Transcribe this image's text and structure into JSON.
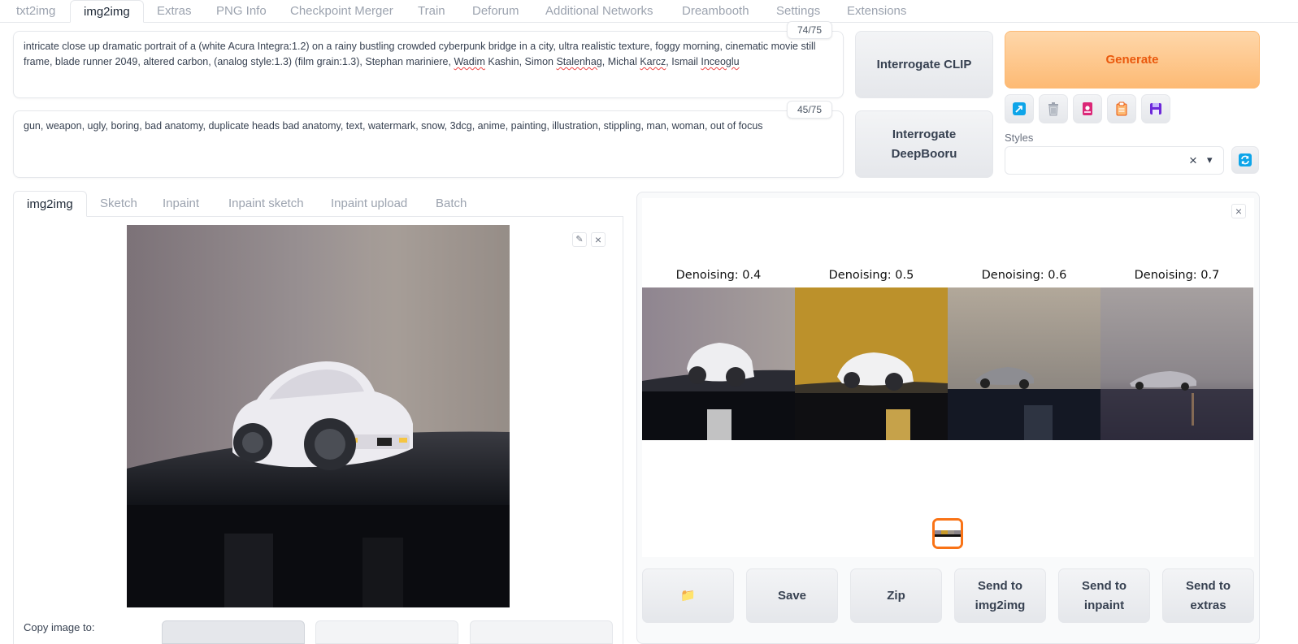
{
  "top_tabs": [
    {
      "label": "txt2img"
    },
    {
      "label": "img2img"
    },
    {
      "label": "Extras"
    },
    {
      "label": "PNG Info"
    },
    {
      "label": "Checkpoint Merger"
    },
    {
      "label": "Train"
    },
    {
      "label": "Deforum"
    },
    {
      "label": "Additional Networks"
    },
    {
      "label": "Dreambooth"
    },
    {
      "label": "Settings"
    },
    {
      "label": "Extensions"
    }
  ],
  "active_top_tab": "img2img",
  "prompt": {
    "text_plain": "intricate close up dramatic portrait of a (white Acura Integra:1.2) on a rainy bustling crowded cyberpunk bridge in a city, ultra realistic texture, foggy morning, cinematic movie still frame, blade runner 2049, altered carbon, (analog style:1.3) (film grain:1.3), Stephan mariniere, ",
    "misspelled_1": "Wadim",
    "word_kashin": "Kashin",
    "text_mid_1": ", Simon ",
    "misspelled_2": "Stalenhag",
    "text_mid_2": ", Michal ",
    "misspelled_3": "Karcz",
    "text_mid_3": ", Ismail ",
    "misspelled_4": "Inceoglu",
    "token_count": "74/75"
  },
  "negative_prompt": {
    "text": "gun, weapon, ugly, boring, bad anatomy, duplicate heads bad anatomy, text, watermark, snow, 3dcg, anime, painting, illustration, stippling, man, woman, out of focus",
    "token_count": "45/75"
  },
  "buttons": {
    "interrogate_clip": "Interrogate CLIP",
    "interrogate_deepbooru_1": "Interrogate",
    "interrogate_deepbooru_2": "DeepBooru",
    "generate": "Generate"
  },
  "styles": {
    "label": "Styles",
    "clear_glyph": "×",
    "arrow_glyph": "▾"
  },
  "sub_tabs": [
    {
      "label": "img2img"
    },
    {
      "label": "Sketch"
    },
    {
      "label": "Inpaint"
    },
    {
      "label": "Inpaint sketch"
    },
    {
      "label": "Inpaint upload"
    },
    {
      "label": "Batch"
    }
  ],
  "input_image": {
    "edit_glyph": "✎",
    "close_glyph": "×"
  },
  "copy_image_to": "Copy image to:",
  "gallery": {
    "close_glyph": "×",
    "captions": [
      "Denoising: 0.4",
      "Denoising: 0.5",
      "Denoising: 0.6",
      "Denoising: 0.7"
    ]
  },
  "output_buttons": {
    "folder_glyph": "📁",
    "save": "Save",
    "zip": "Zip",
    "send_img2img_1": "Send to",
    "send_img2img_2": "img2img",
    "send_inpaint_1": "Send to",
    "send_inpaint_2": "inpaint",
    "send_extras_1": "Send to",
    "send_extras_2": "extras"
  },
  "colors": {
    "accent_orange": "#f97316",
    "generate_text": "#ea580c",
    "checkbox_blue": "#0ea5e9",
    "refresh_blue": "#0ea5e9"
  }
}
